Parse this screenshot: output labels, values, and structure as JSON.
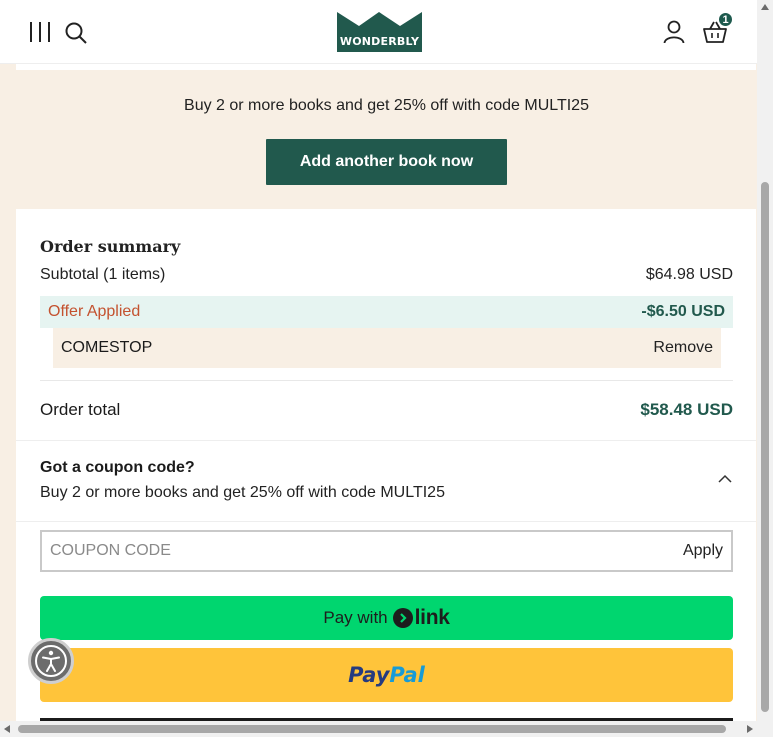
{
  "header": {
    "logo_text": "WONDERBLY",
    "basket_count": "1",
    "icons": [
      "menu-icon",
      "search-icon",
      "user-icon",
      "basket-icon"
    ]
  },
  "promo": {
    "text": "Buy 2 or more books and get 25% off with code MULTI25",
    "button_label": "Add another book now"
  },
  "summary": {
    "title": "Order summary",
    "subtotal_label": "Subtotal (1 items)",
    "subtotal_value": "$64.98 USD",
    "offer_label": "Offer Applied",
    "offer_value": "-$6.50 USD",
    "code": "COMESTOP",
    "remove_label": "Remove",
    "total_label": "Order total",
    "total_value": "$58.48 USD"
  },
  "coupon": {
    "heading": "Got a coupon code?",
    "subtext": "Buy 2 or more books and get 25% off with code MULTI25",
    "placeholder": "COUPON CODE",
    "value": "",
    "apply_label": "Apply"
  },
  "payments": {
    "link_prefix": "Pay with",
    "link_word": "link",
    "paypal_pay": "Pay",
    "paypal_pal": "Pal"
  },
  "colors": {
    "brand_green": "#21594d",
    "page_bg": "#f8efe4",
    "offer_bg": "#e6f4f1",
    "offer_label": "#c4522f",
    "link_green": "#00d66f",
    "paypal_yellow": "#ffc43a"
  }
}
